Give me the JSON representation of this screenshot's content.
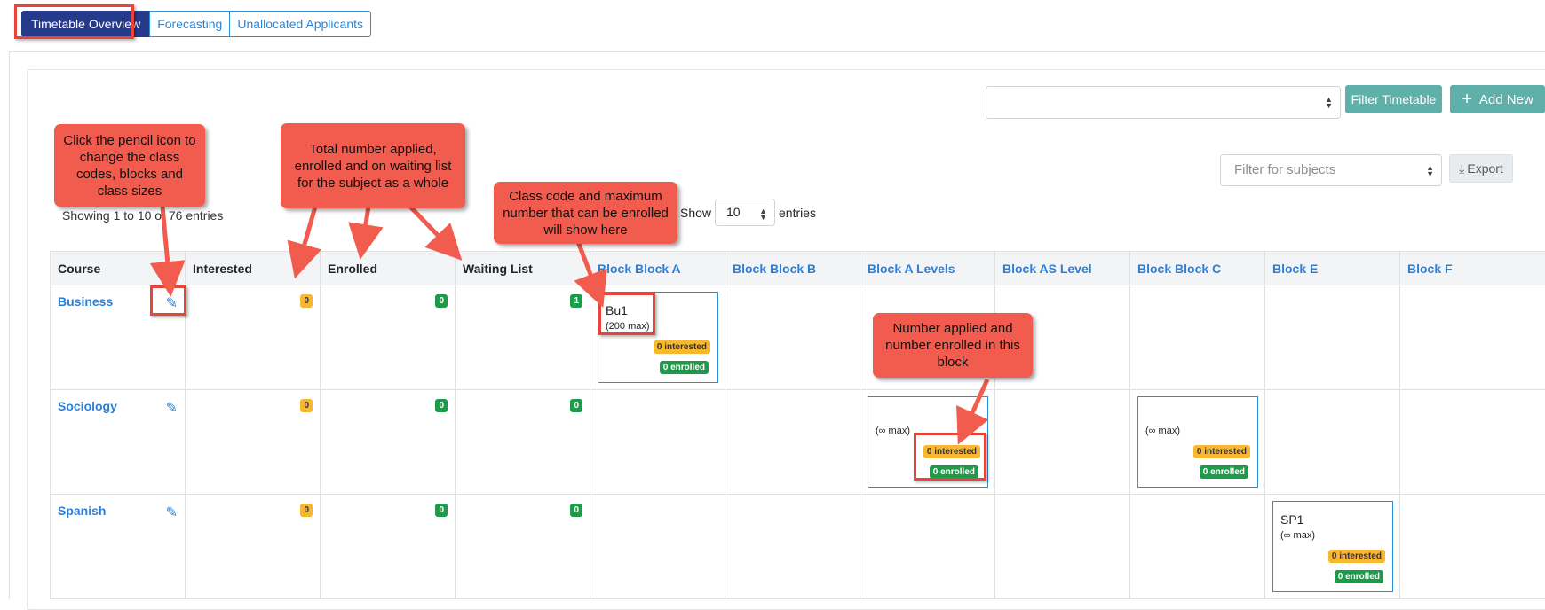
{
  "tabs": [
    "Timetable Overview",
    "Forecasting",
    "Unallocated Applicants"
  ],
  "toolbar": {
    "filter_timetable": "Filter Timetable",
    "add_new": "Add New",
    "filter_subjects_placeholder": "Filter for subjects",
    "export": "Export"
  },
  "table_info": {
    "showing": "Showing 1 to 10 of 76 entries",
    "show_label": "Show",
    "page_size": "10",
    "entries_label": "entries"
  },
  "columns": [
    "Course",
    "Interested",
    "Enrolled",
    "Waiting List",
    "Block Block A",
    "Block Block B",
    "Block A Levels",
    "Block AS Level",
    "Block Block C",
    "Block E",
    "Block F"
  ],
  "rows": [
    {
      "course": "Business",
      "interested": "0",
      "enrolled": "0",
      "waiting": "1",
      "class_a": {
        "code": "Bu1",
        "max": "(200 max)",
        "interested": "0 interested",
        "enrolled": "0 enrolled"
      }
    },
    {
      "course": "Sociology",
      "interested": "0",
      "enrolled": "0",
      "waiting": "0",
      "class_alevels": {
        "code": "",
        "max": "(∞ max)",
        "interested": "0 interested",
        "enrolled": "0 enrolled"
      },
      "class_c": {
        "code": "",
        "max": "(∞ max)",
        "interested": "0 interested",
        "enrolled": "0 enrolled"
      }
    },
    {
      "course": "Spanish",
      "interested": "0",
      "enrolled": "0",
      "waiting": "0",
      "class_e": {
        "code": "SP1",
        "max": "(∞ max)",
        "interested": "0 interested",
        "enrolled": "0 enrolled"
      }
    }
  ],
  "callouts": {
    "pencil": "Click the pencil icon to change the class codes, blocks and class sizes",
    "totals": "Total number applied, enrolled and on waiting list for the subject as a whole",
    "classcode": "Class code and maximum number that can be enrolled will show here",
    "block": "Number applied and number enrolled in this block"
  },
  "colors": {
    "active_tab": "#263a8c",
    "teal_button": "#5fb0aa",
    "link_blue": "#2b7fd6",
    "badge_yellow": "#f7b731",
    "badge_green": "#1e9b4a",
    "callout_red": "#f25c4f"
  }
}
